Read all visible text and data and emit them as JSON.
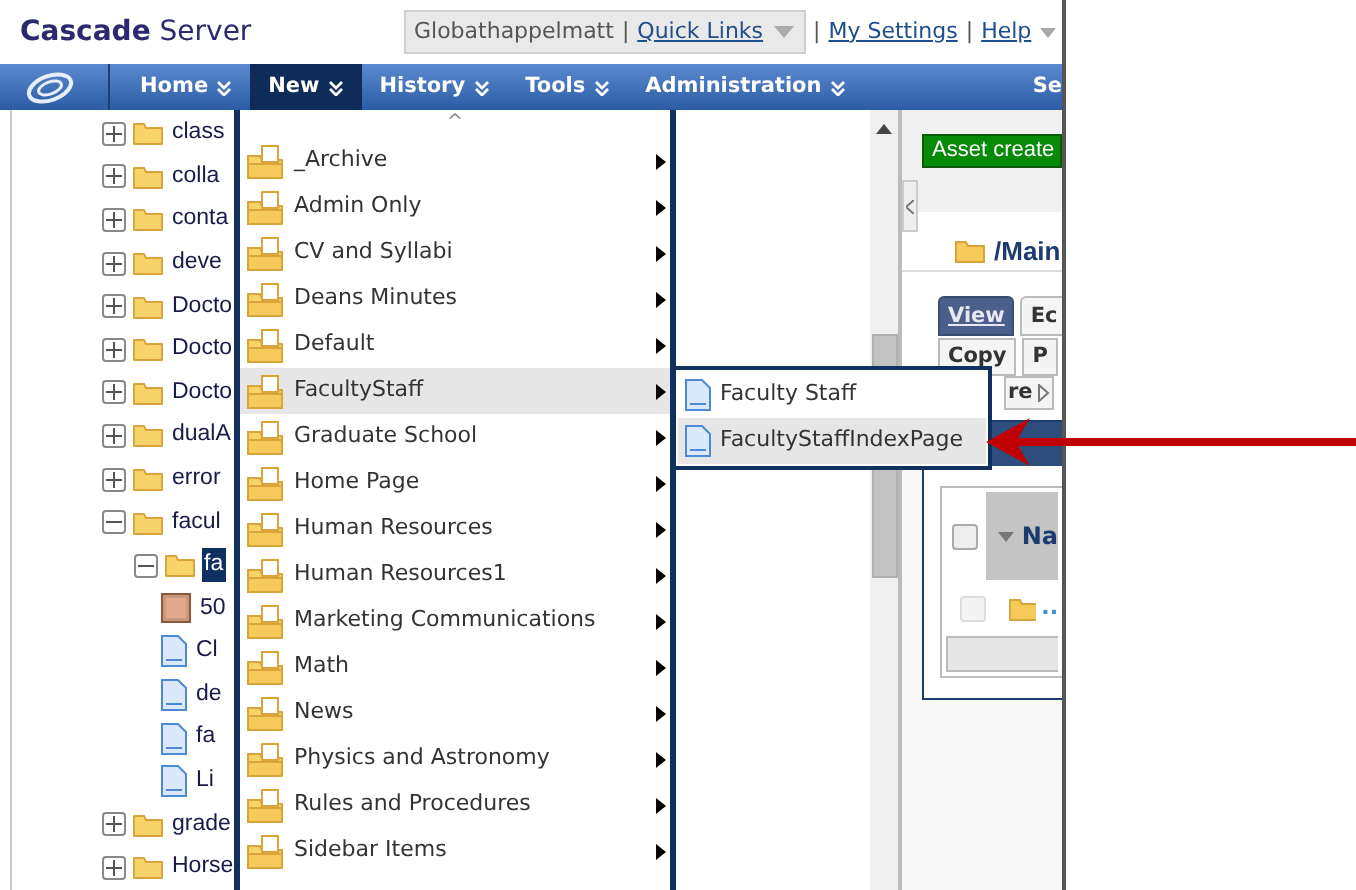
{
  "header": {
    "logo": "**Cascade** Server",
    "user": "Globathappelmatt",
    "user_separator": "|",
    "quick_links": "Quick Links",
    "links": [
      {
        "separator": "|",
        "label": "My Settings"
      },
      {
        "separator": "|",
        "label": "Help"
      }
    ]
  },
  "nav": [
    {
      "label": "Home",
      "selected": false
    },
    {
      "label": "New",
      "selected": true
    },
    {
      "label": "History",
      "selected": false
    },
    {
      "label": "Tools",
      "selected": false
    },
    {
      "label": "Administration",
      "selected": false
    },
    {
      "label": "Se",
      "selected": false
    }
  ],
  "tree": [
    {
      "label": "class",
      "kind": "folder",
      "expanded": false,
      "selected": false
    },
    {
      "label": "colla",
      "kind": "folder",
      "expanded": false,
      "selected": false
    },
    {
      "label": "conta",
      "kind": "folder",
      "expanded": false,
      "selected": false
    },
    {
      "label": "deve",
      "kind": "folder",
      "expanded": false,
      "selected": false
    },
    {
      "label": "Docto",
      "kind": "folder",
      "expanded": false,
      "selected": false
    },
    {
      "label": "Docto",
      "kind": "folder",
      "expanded": false,
      "selected": false
    },
    {
      "label": "Docto",
      "kind": "folder",
      "expanded": false,
      "selected": false
    },
    {
      "label": "dualA",
      "kind": "folder",
      "expanded": false,
      "selected": false
    },
    {
      "label": "error",
      "kind": "folder",
      "expanded": false,
      "selected": false
    },
    {
      "label": "facul",
      "kind": "folder",
      "expanded": true,
      "selected": false,
      "children": [
        {
          "label": "fa",
          "kind": "folder",
          "expanded": true,
          "selected": true,
          "children": [
            {
              "label": "50",
              "kind": "image",
              "selected": false
            },
            {
              "label": "Cl",
              "kind": "page",
              "selected": false
            },
            {
              "label": "de",
              "kind": "page",
              "selected": false
            },
            {
              "label": "fa",
              "kind": "page",
              "selected": false
            },
            {
              "label": "Li",
              "kind": "page",
              "selected": false
            }
          ]
        }
      ]
    },
    {
      "label": "grade",
      "kind": "folder",
      "expanded": false,
      "selected": false
    },
    {
      "label": "Horse",
      "kind": "folder",
      "expanded": false,
      "selected": false
    }
  ],
  "new_menu": {
    "scroll_up": "^",
    "items": [
      {
        "label": "_Archive",
        "selected": false
      },
      {
        "label": "Admin Only",
        "selected": false
      },
      {
        "label": "CV and Syllabi",
        "selected": false
      },
      {
        "label": "Deans Minutes",
        "selected": false
      },
      {
        "label": "Default",
        "selected": false
      },
      {
        "label": "FacultyStaff",
        "selected": true
      },
      {
        "label": "Graduate School",
        "selected": false
      },
      {
        "label": "Home Page",
        "selected": false
      },
      {
        "label": "Human Resources",
        "selected": false
      },
      {
        "label": "Human Resources1",
        "selected": false
      },
      {
        "label": "Marketing Communications",
        "selected": false
      },
      {
        "label": "Math",
        "selected": false
      },
      {
        "label": "News",
        "selected": false
      },
      {
        "label": "Physics and Astronomy",
        "selected": false
      },
      {
        "label": "Rules and Procedures",
        "selected": false
      },
      {
        "label": "Sidebar Items",
        "selected": false
      }
    ]
  },
  "submenu": {
    "items": [
      {
        "label": "Faculty Staff",
        "selected": false
      },
      {
        "label": "FacultyStaffIndexPage",
        "selected": true
      }
    ]
  },
  "content": {
    "banner": "Asset create",
    "path": "/Main",
    "tabs": [
      {
        "label": "View",
        "selected": true
      },
      {
        "label": "Ec",
        "selected": false
      }
    ],
    "actions": [
      "Copy",
      "P"
    ],
    "more": "re",
    "table": {
      "header": "Na",
      "header_checked": false,
      "row": "..",
      "row_checked": false
    }
  }
}
